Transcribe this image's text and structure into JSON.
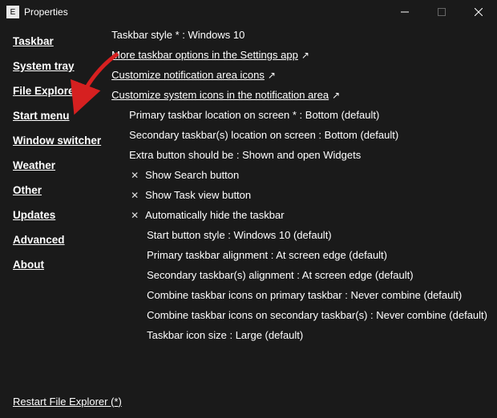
{
  "titlebar": {
    "title": "Properties"
  },
  "sidebar": {
    "items": [
      {
        "label": "Taskbar"
      },
      {
        "label": "System tray"
      },
      {
        "label": "File Explorer"
      },
      {
        "label": "Start menu"
      },
      {
        "label": "Window switcher"
      },
      {
        "label": "Weather"
      },
      {
        "label": "Other"
      },
      {
        "label": "Updates"
      },
      {
        "label": "Advanced"
      },
      {
        "label": "About"
      }
    ]
  },
  "main": {
    "rows": [
      {
        "label": "Taskbar style *",
        "value": "Windows 10",
        "indent": 0,
        "type": "kv"
      },
      {
        "label": "More taskbar options in the Settings app",
        "indent": 0,
        "type": "link"
      },
      {
        "label": "Customize notification area icons",
        "indent": 0,
        "type": "link"
      },
      {
        "label": "Customize system icons in the notification area",
        "indent": 0,
        "type": "link"
      },
      {
        "label": "Primary taskbar location on screen *",
        "value": "Bottom (default)",
        "indent": 1,
        "type": "kv"
      },
      {
        "label": "Secondary taskbar(s) location on screen",
        "value": "Bottom (default)",
        "indent": 1,
        "type": "kv"
      },
      {
        "label": "Extra button should be",
        "value": "Shown and open Widgets",
        "indent": 1,
        "type": "kv"
      },
      {
        "label": "Show Search button",
        "indent": 1,
        "type": "check"
      },
      {
        "label": "Show Task view button",
        "indent": 1,
        "type": "check"
      },
      {
        "label": "Automatically hide the taskbar",
        "indent": 1,
        "type": "check"
      },
      {
        "label": "Start button style",
        "value": "Windows 10 (default)",
        "indent": 2,
        "type": "kv"
      },
      {
        "label": "Primary taskbar alignment",
        "value": "At screen edge (default)",
        "indent": 2,
        "type": "kv"
      },
      {
        "label": "Secondary taskbar(s) alignment",
        "value": "At screen edge (default)",
        "indent": 2,
        "type": "kv"
      },
      {
        "label": "Combine taskbar icons on primary taskbar",
        "value": "Never combine (default)",
        "indent": 2,
        "type": "kv"
      },
      {
        "label": "Combine taskbar icons on secondary taskbar(s)",
        "value": "Never combine (default)",
        "indent": 2,
        "type": "kv"
      },
      {
        "label": "Taskbar icon size",
        "value": "Large (default)",
        "indent": 2,
        "type": "kv"
      }
    ]
  },
  "footer": {
    "restart_label": "Restart File Explorer (*)"
  }
}
